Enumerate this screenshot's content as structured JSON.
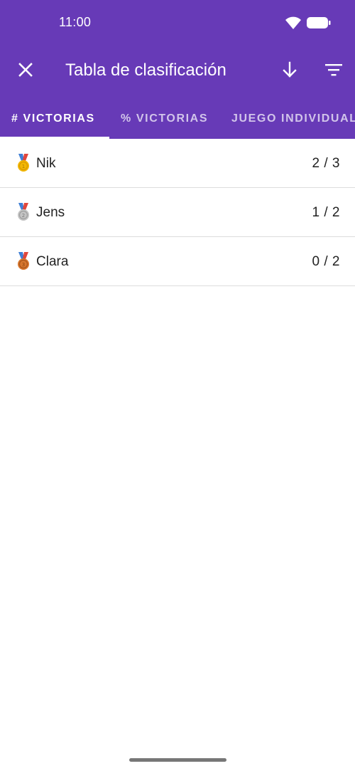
{
  "status_bar": {
    "time": "11:00",
    "icons": [
      "wifi-icon",
      "battery-icon"
    ]
  },
  "toolbar": {
    "title": "Tabla de clasificación",
    "close_icon": "close-icon",
    "sort_icon": "arrow-down-icon",
    "filter_icon": "filter-icon"
  },
  "tabs": [
    {
      "label": "# VICTORIAS",
      "selected": true
    },
    {
      "label": "% VICTORIAS",
      "selected": false
    },
    {
      "label": "JUEGO INDIVIDUAL",
      "selected": false
    }
  ],
  "leaderboard": [
    {
      "medal": "gold-medal-icon",
      "medal_color": "#f2b705",
      "name": "Nik",
      "score": "2 / 3"
    },
    {
      "medal": "silver-medal-icon",
      "medal_color": "#b8b8b8",
      "name": "Jens",
      "score": "1 / 2"
    },
    {
      "medal": "bronze-medal-icon",
      "medal_color": "#d7772e",
      "name": "Clara",
      "score": "0 / 2"
    }
  ],
  "colors": {
    "primary": "#673ab7",
    "on_primary": "#ffffff",
    "divider": "#dcdcdc",
    "text": "#222222"
  }
}
